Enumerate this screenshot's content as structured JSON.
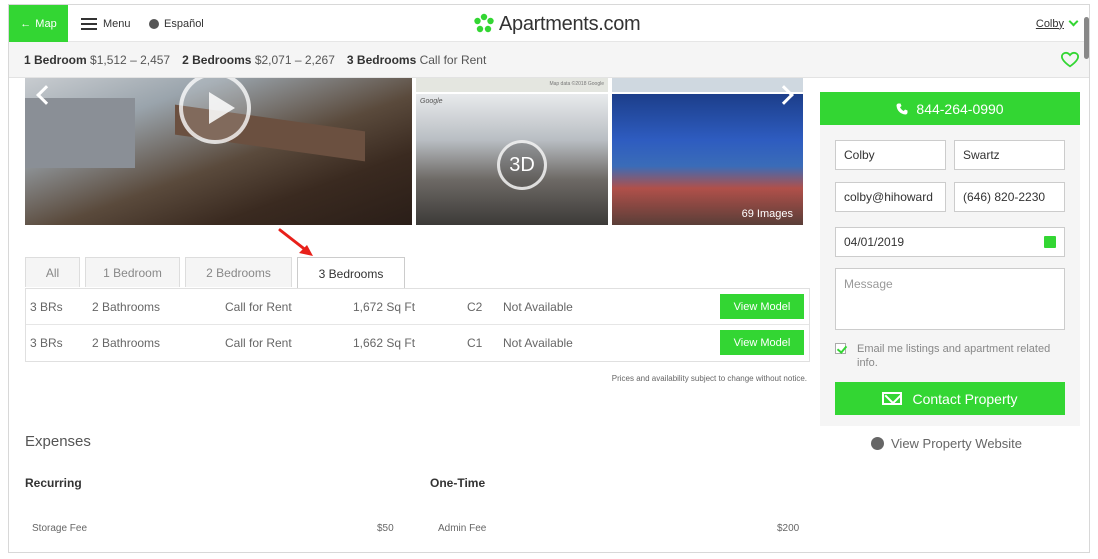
{
  "header": {
    "map_label": "Map",
    "menu_label": "Menu",
    "language_label": "Español",
    "logo_text": "Apartments.com",
    "logo_tm": "·",
    "user_name": "Colby"
  },
  "pricebar": {
    "items": [
      {
        "beds": "1 Bedroom",
        "price": "$1,512 – 2,457"
      },
      {
        "beds": "2 Bedrooms",
        "price": "$2,071 – 2,267"
      },
      {
        "beds": "3 Bedrooms",
        "price": "Call for Rent"
      }
    ]
  },
  "gallery": {
    "image_count": "69 Images",
    "badge_3d": "3D",
    "google_label": "Google",
    "map_data_label": "Map data ©2018 Google"
  },
  "tabs": {
    "all": "All",
    "one_bed": "1 Bedroom",
    "two_bed": "2 Bedrooms",
    "three_bed": "3 Bedrooms",
    "active": "3 Bedrooms"
  },
  "units": [
    {
      "beds": "3 BRs",
      "baths": "2 Bathrooms",
      "rent": "Call for Rent",
      "sqft": "1,672 Sq Ft",
      "model": "C2",
      "availability": "Not Available",
      "button": "View Model"
    },
    {
      "beds": "3 BRs",
      "baths": "2 Bathrooms",
      "rent": "Call for Rent",
      "sqft": "1,662 Sq Ft",
      "model": "C1",
      "availability": "Not Available",
      "button": "View Model"
    }
  ],
  "disclaimer": "Prices and availability subject to change without notice.",
  "expenses": {
    "title": "Expenses",
    "recurring_label": "Recurring",
    "onetime_label": "One-Time",
    "recurring": [
      {
        "name": "Storage Fee",
        "amount": "$50"
      }
    ],
    "onetime": [
      {
        "name": "Admin Fee",
        "amount": "$200"
      }
    ]
  },
  "contact": {
    "phone": "844-264-0990",
    "first_name": "Colby",
    "last_name": "Swartz",
    "email": "colby@hihoward",
    "phone_field": "(646) 820-2230",
    "move_date": "04/01/2019",
    "message_placeholder": "Message",
    "email_opt_in": "Email me listings and apartment related info.",
    "email_opt_in_checked": true,
    "submit_label": "Contact Property",
    "website_label": "View Property Website"
  },
  "colors": {
    "accent": "#33d633",
    "annotation": "#e8201a"
  }
}
